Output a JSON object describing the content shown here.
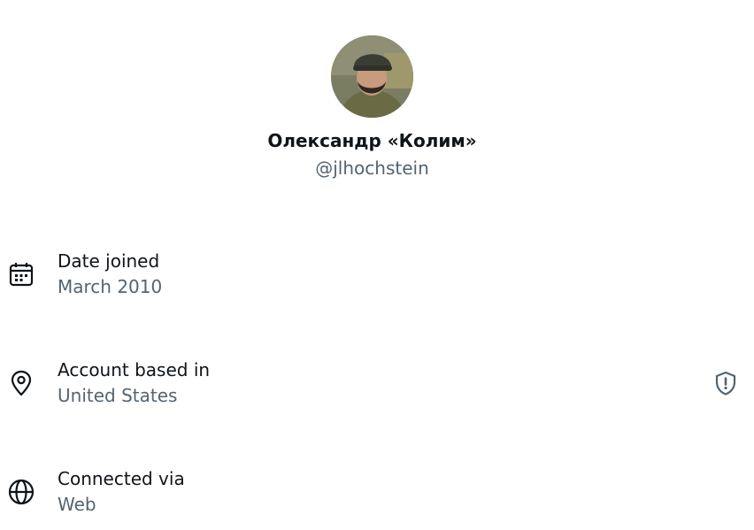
{
  "profile": {
    "display_name": "Олександр «Колим»",
    "handle": "@jlhochstein",
    "avatar_icon": "user-avatar"
  },
  "about": {
    "items": [
      {
        "icon": "calendar-icon",
        "title": "Date joined",
        "value": "March 2010"
      },
      {
        "icon": "location-pin-icon",
        "title": "Account based in",
        "value": "United States"
      },
      {
        "icon": "globe-icon",
        "title": "Connected via",
        "value": "Web"
      }
    ],
    "location_action_icon": "shield-alert-icon"
  },
  "colors": {
    "primary_text": "#0f1419",
    "secondary_text": "#536471"
  }
}
